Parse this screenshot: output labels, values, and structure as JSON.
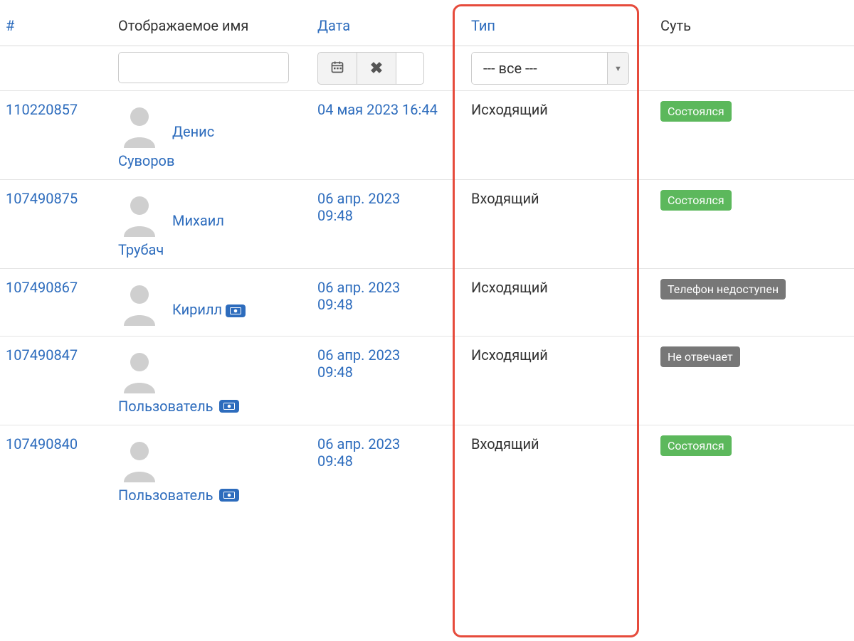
{
  "headers": {
    "id": "#",
    "name": "Отображаемое имя",
    "date": "Дата",
    "type": "Тип",
    "status": "Суть"
  },
  "filters": {
    "name_value": "",
    "type_select_value": "--- все ---"
  },
  "status_palette": {
    "success": "#5cb85c",
    "neutral": "#777"
  },
  "rows": [
    {
      "id": "110220857",
      "first_name": "Денис",
      "last_name": "Суворов",
      "has_money_badge": false,
      "money_on_last": false,
      "date": "04 мая 2023 16:44",
      "type": "Исходящий",
      "status_label": "Состоялся",
      "status_kind": "success"
    },
    {
      "id": "107490875",
      "first_name": "Михаил",
      "last_name": "Трубач",
      "has_money_badge": false,
      "money_on_last": false,
      "date": "06 апр. 2023 09:48",
      "type": "Входящий",
      "status_label": "Состоялся",
      "status_kind": "success"
    },
    {
      "id": "107490867",
      "first_name": "Кирилл",
      "last_name": "",
      "has_money_badge": true,
      "money_on_last": false,
      "date": "06 апр. 2023 09:48",
      "type": "Исходящий",
      "status_label": "Телефон недоступен",
      "status_kind": "neutral"
    },
    {
      "id": "107490847",
      "first_name": "",
      "last_name": "Пользователь",
      "has_money_badge": true,
      "money_on_last": true,
      "date": "06 апр. 2023 09:48",
      "type": "Исходящий",
      "status_label": "Не отвечает",
      "status_kind": "neutral"
    },
    {
      "id": "107490840",
      "first_name": "",
      "last_name": "Пользователь",
      "has_money_badge": true,
      "money_on_last": true,
      "date": "06 апр. 2023 09:48",
      "type": "Входящий",
      "status_label": "Состоялся",
      "status_kind": "success"
    }
  ]
}
